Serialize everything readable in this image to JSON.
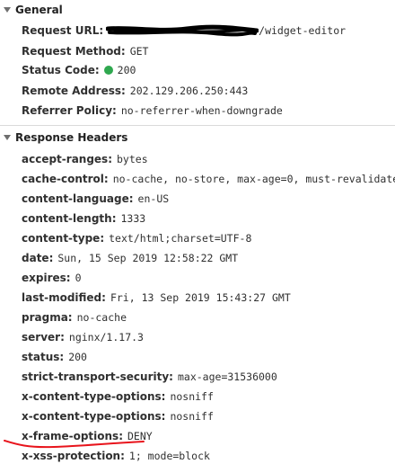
{
  "general": {
    "title": "General",
    "rows": [
      {
        "name": "Request URL:",
        "value": "/widget-editor"
      },
      {
        "name": "Request Method:",
        "value": "GET"
      },
      {
        "name": "Status Code:",
        "value": "200"
      },
      {
        "name": "Remote Address:",
        "value": "202.129.206.250:443"
      },
      {
        "name": "Referrer Policy:",
        "value": "no-referrer-when-downgrade"
      }
    ]
  },
  "response_headers": {
    "title": "Response Headers",
    "rows": [
      {
        "name": "accept-ranges:",
        "value": "bytes"
      },
      {
        "name": "cache-control:",
        "value": "no-cache, no-store, max-age=0, must-revalidate"
      },
      {
        "name": "content-language:",
        "value": "en-US"
      },
      {
        "name": "content-length:",
        "value": "1333"
      },
      {
        "name": "content-type:",
        "value": "text/html;charset=UTF-8"
      },
      {
        "name": "date:",
        "value": "Sun, 15 Sep 2019 12:58:22 GMT"
      },
      {
        "name": "expires:",
        "value": "0"
      },
      {
        "name": "last-modified:",
        "value": "Fri, 13 Sep 2019 15:43:27 GMT"
      },
      {
        "name": "pragma:",
        "value": "no-cache"
      },
      {
        "name": "server:",
        "value": "nginx/1.17.3"
      },
      {
        "name": "status:",
        "value": "200"
      },
      {
        "name": "strict-transport-security:",
        "value": "max-age=31536000"
      },
      {
        "name": "x-content-type-options:",
        "value": "nosniff"
      },
      {
        "name": "x-content-type-options:",
        "value": "nosniff"
      },
      {
        "name": "x-frame-options:",
        "value": "DENY"
      },
      {
        "name": "x-xss-protection:",
        "value": "1; mode=block"
      }
    ]
  },
  "colors": {
    "status_ok": "#2fa84f",
    "annotation": "#e8141c",
    "redaction": "#000000"
  }
}
